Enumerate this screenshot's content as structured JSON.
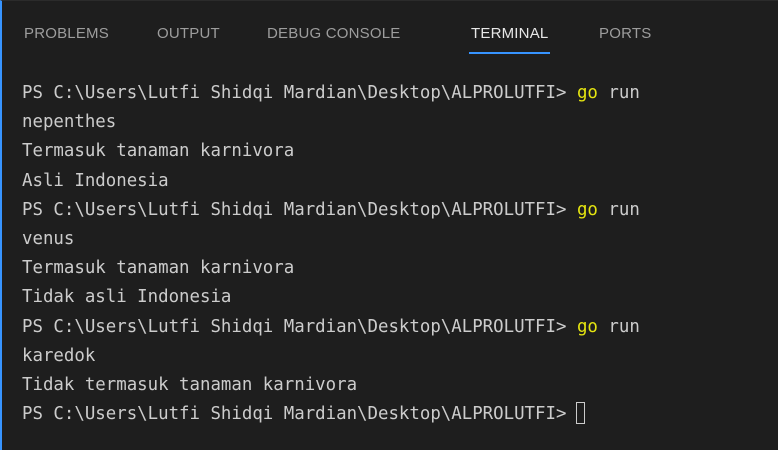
{
  "panel": {
    "tabs": [
      {
        "label": "PROBLEMS",
        "active": false
      },
      {
        "label": "OUTPUT",
        "active": false
      },
      {
        "label": "DEBUG CONSOLE",
        "active": false
      },
      {
        "label": "TERMINAL",
        "active": true
      },
      {
        "label": "PORTS",
        "active": false
      }
    ]
  },
  "terminal": {
    "lines": [
      {
        "prompt": "PS C:\\Users\\Lutfi Shidqi Mardian\\Desktop\\ALPROLUTFI>",
        "cmd": "go",
        "args": "run"
      },
      {
        "text": "nepenthes"
      },
      {
        "text": "Termasuk tanaman karnivora"
      },
      {
        "text": "Asli Indonesia"
      },
      {
        "prompt": "PS C:\\Users\\Lutfi Shidqi Mardian\\Desktop\\ALPROLUTFI>",
        "cmd": "go",
        "args": "run"
      },
      {
        "text": "venus"
      },
      {
        "text": "Termasuk tanaman karnivora"
      },
      {
        "text": "Tidak asli Indonesia"
      },
      {
        "prompt": "PS C:\\Users\\Lutfi Shidqi Mardian\\Desktop\\ALPROLUTFI>",
        "cmd": "go",
        "args": "run"
      },
      {
        "text": "karedok"
      },
      {
        "text": "Tidak termasuk tanaman karnivora"
      },
      {
        "prompt": "PS C:\\Users\\Lutfi Shidqi Mardian\\Desktop\\ALPROLUTFI>"
      }
    ]
  },
  "colors": {
    "background": "#1e1e1e",
    "text": "#cccccc",
    "command": "#e5e510",
    "accent": "#3794ff"
  }
}
